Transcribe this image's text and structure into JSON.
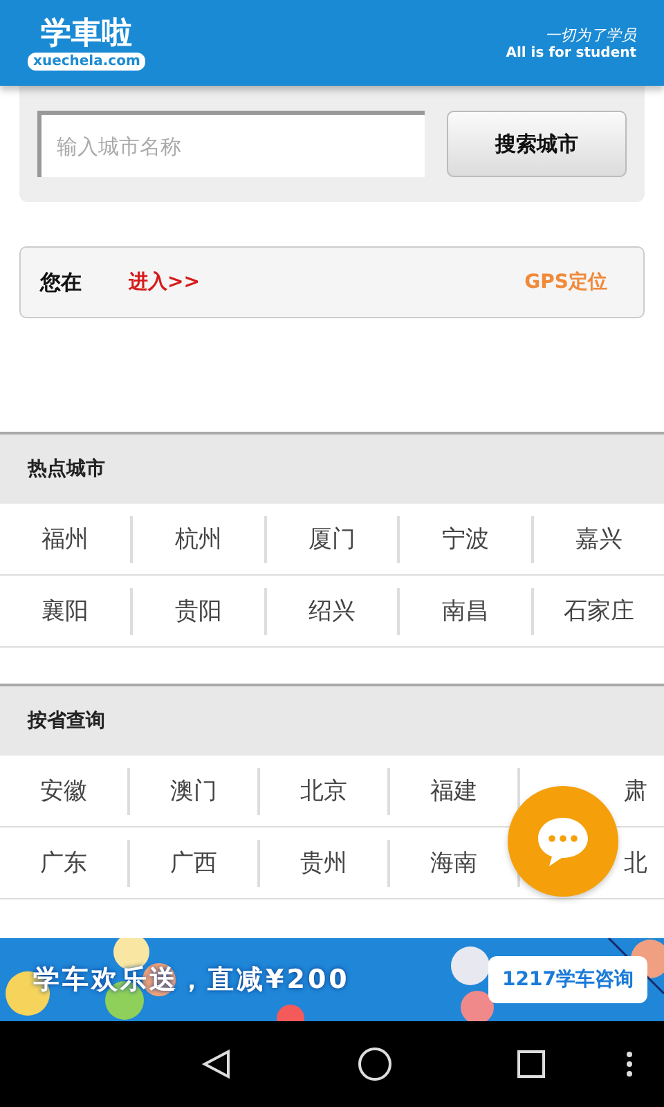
{
  "header": {
    "logo_text": "学車啦",
    "logo_domain": "xuechela.com",
    "slogan_script": "一切为了学员",
    "slogan": "All is for student"
  },
  "search": {
    "placeholder": "输入城市名称",
    "button": "搜索城市"
  },
  "location": {
    "label": "您在",
    "enter_link": "进入>>",
    "gps_button": "GPS定位"
  },
  "hot_cities": {
    "title": "热点城市",
    "rows": [
      [
        "福州",
        "杭州",
        "厦门",
        "宁波",
        "嘉兴"
      ],
      [
        "襄阳",
        "贵阳",
        "绍兴",
        "南昌",
        "石家庄"
      ]
    ]
  },
  "provinces": {
    "title": "按省查询",
    "rows": [
      [
        "安徽",
        "澳门",
        "北京",
        "福建",
        "肃"
      ],
      [
        "广东",
        "广西",
        "贵州",
        "海南",
        "北"
      ]
    ]
  },
  "banner": {
    "headline": "学车欢乐送，直减¥200",
    "button": "1217学车咨询"
  }
}
